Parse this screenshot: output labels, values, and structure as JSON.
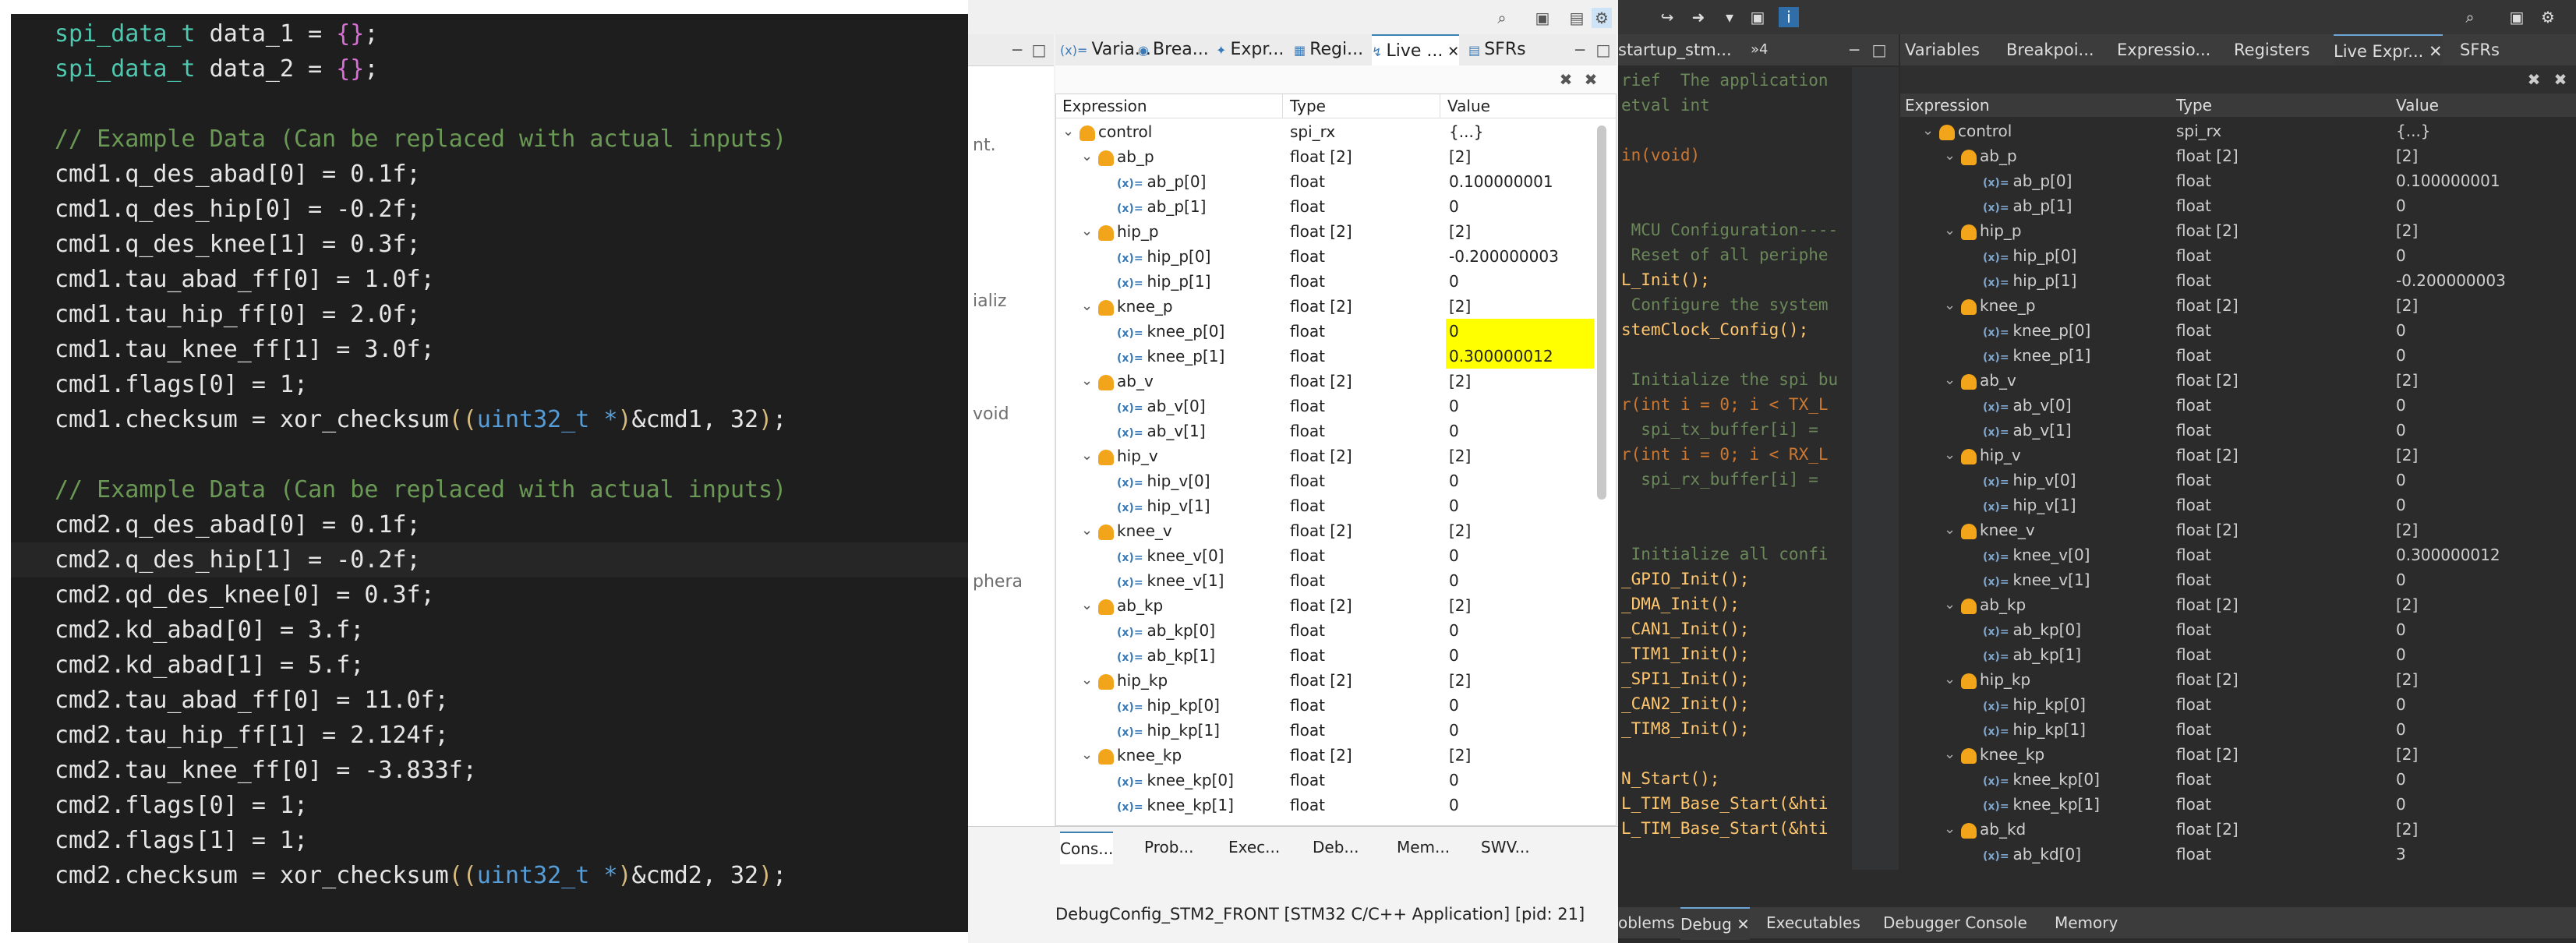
{
  "code": {
    "lines": [
      {
        "text": "spi_data_t data_1 = {};"
      },
      {
        "text": "spi_data_t data_2 = {};"
      },
      {
        "text": ""
      },
      {
        "text": "// Example Data (Can be replaced with actual inputs)"
      },
      {
        "text": "cmd1.q_des_abad[0] = 0.1f;"
      },
      {
        "text": "cmd1.q_des_hip[0] = -0.2f;"
      },
      {
        "text": "cmd1.q_des_knee[1] = 0.3f;"
      },
      {
        "text": "cmd1.tau_abad_ff[0] = 1.0f;"
      },
      {
        "text": "cmd1.tau_hip_ff[0] = 2.0f;"
      },
      {
        "text": "cmd1.tau_knee_ff[1] = 3.0f;"
      },
      {
        "text": "cmd1.flags[0] = 1;"
      },
      {
        "text": "cmd1.checksum = xor_checksum((uint32_t *)&cmd1, 32);"
      },
      {
        "text": ""
      },
      {
        "text": "// Example Data (Can be replaced with actual inputs)"
      },
      {
        "text": "cmd2.q_des_abad[0] = 0.1f;"
      },
      {
        "text": "cmd2.q_des_hip[1] = -0.2f;"
      },
      {
        "text": "cmd2.qd_des_knee[0] = 0.3f;"
      },
      {
        "text": "cmd2.kd_abad[0] = 3.f;"
      },
      {
        "text": "cmd2.kd_abad[1] = 5.f;"
      },
      {
        "text": "cmd2.tau_abad_ff[0] = 11.0f;"
      },
      {
        "text": "cmd2.tau_hip_ff[1] = 2.124f;"
      },
      {
        "text": "cmd2.tau_knee_ff[0] = -3.833f;"
      },
      {
        "text": "cmd2.flags[0] = 1;"
      },
      {
        "text": "cmd2.flags[1] = 1;"
      },
      {
        "text": "cmd2.checksum = xor_checksum((uint32_t *)&cmd2, 32);"
      }
    ]
  },
  "panel_a": {
    "editor_fragments": [
      "nt.",
      "ializ",
      "void",
      "phera"
    ],
    "tabs": [
      "Varia...",
      "Brea...",
      "Expr...",
      "Regi...",
      "Live ...",
      "SFRs"
    ],
    "active_tab": "Live ...",
    "columns": [
      "Expression",
      "Type",
      "Value"
    ],
    "rows": [
      {
        "expr": "control",
        "type": "spi_rx",
        "value": "{...}",
        "level": 0,
        "kind": "struct"
      },
      {
        "expr": "ab_p",
        "type": "float [2]",
        "value": "[2]",
        "level": 1,
        "kind": "struct"
      },
      {
        "expr": "ab_p[0]",
        "type": "float",
        "value": "0.100000001",
        "level": 2,
        "kind": "var"
      },
      {
        "expr": "ab_p[1]",
        "type": "float",
        "value": "0",
        "level": 2,
        "kind": "var"
      },
      {
        "expr": "hip_p",
        "type": "float [2]",
        "value": "[2]",
        "level": 1,
        "kind": "struct"
      },
      {
        "expr": "hip_p[0]",
        "type": "float",
        "value": "-0.200000003",
        "level": 2,
        "kind": "var"
      },
      {
        "expr": "hip_p[1]",
        "type": "float",
        "value": "0",
        "level": 2,
        "kind": "var"
      },
      {
        "expr": "knee_p",
        "type": "float [2]",
        "value": "[2]",
        "level": 1,
        "kind": "struct"
      },
      {
        "expr": "knee_p[0]",
        "type": "float",
        "value": "0",
        "level": 2,
        "kind": "var",
        "highlight": true
      },
      {
        "expr": "knee_p[1]",
        "type": "float",
        "value": "0.300000012",
        "level": 2,
        "kind": "var",
        "highlight": true
      },
      {
        "expr": "ab_v",
        "type": "float [2]",
        "value": "[2]",
        "level": 1,
        "kind": "struct"
      },
      {
        "expr": "ab_v[0]",
        "type": "float",
        "value": "0",
        "level": 2,
        "kind": "var"
      },
      {
        "expr": "ab_v[1]",
        "type": "float",
        "value": "0",
        "level": 2,
        "kind": "var"
      },
      {
        "expr": "hip_v",
        "type": "float [2]",
        "value": "[2]",
        "level": 1,
        "kind": "struct"
      },
      {
        "expr": "hip_v[0]",
        "type": "float",
        "value": "0",
        "level": 2,
        "kind": "var"
      },
      {
        "expr": "hip_v[1]",
        "type": "float",
        "value": "0",
        "level": 2,
        "kind": "var"
      },
      {
        "expr": "knee_v",
        "type": "float [2]",
        "value": "[2]",
        "level": 1,
        "kind": "struct"
      },
      {
        "expr": "knee_v[0]",
        "type": "float",
        "value": "0",
        "level": 2,
        "kind": "var"
      },
      {
        "expr": "knee_v[1]",
        "type": "float",
        "value": "0",
        "level": 2,
        "kind": "var"
      },
      {
        "expr": "ab_kp",
        "type": "float [2]",
        "value": "[2]",
        "level": 1,
        "kind": "struct"
      },
      {
        "expr": "ab_kp[0]",
        "type": "float",
        "value": "0",
        "level": 2,
        "kind": "var"
      },
      {
        "expr": "ab_kp[1]",
        "type": "float",
        "value": "0",
        "level": 2,
        "kind": "var"
      },
      {
        "expr": "hip_kp",
        "type": "float [2]",
        "value": "[2]",
        "level": 1,
        "kind": "struct"
      },
      {
        "expr": "hip_kp[0]",
        "type": "float",
        "value": "0",
        "level": 2,
        "kind": "var"
      },
      {
        "expr": "hip_kp[1]",
        "type": "float",
        "value": "0",
        "level": 2,
        "kind": "var"
      },
      {
        "expr": "knee_kp",
        "type": "float [2]",
        "value": "[2]",
        "level": 1,
        "kind": "struct"
      },
      {
        "expr": "knee_kp[0]",
        "type": "float",
        "value": "0",
        "level": 2,
        "kind": "var"
      },
      {
        "expr": "knee_kp[1]",
        "type": "float",
        "value": "0",
        "level": 2,
        "kind": "var"
      }
    ],
    "console_tabs": [
      "Cons...",
      "Prob...",
      "Exec...",
      "Deb...",
      "Mem...",
      "SWV..."
    ],
    "console_text": "DebugConfig_STM2_FRONT [STM32 C/C++ Application]  [pid: 21]"
  },
  "panel_b": {
    "editor_tab": "startup_stm...",
    "editor_tab_count": "»4",
    "editor_lines": [
      "rief  The application",
      "etval int",
      "",
      "in(void)",
      "",
      "",
      " MCU Configuration----",
      " Reset of all periphe",
      "L_Init();",
      " Configure the system",
      "stemClock_Config();",
      "",
      " Initialize the spi bu",
      "r(int i = 0; i < TX_L",
      "  spi_tx_buffer[i] =",
      "r(int i = 0; i < RX_L",
      "  spi_rx_buffer[i] =",
      "",
      "",
      " Initialize all confi",
      "_GPIO_Init();",
      "_DMA_Init();",
      "_CAN1_Init();",
      "_TIM1_Init();",
      "_SPI1_Init();",
      "_CAN2_Init();",
      "_TIM8_Init();",
      "",
      "N_Start();",
      "L_TIM_Base_Start(&hti",
      "L_TIM_Base_Start(&hti"
    ],
    "tabs": [
      "Variables",
      "Breakpoi...",
      "Expressio...",
      "Registers",
      "Live Expr...",
      "SFRs"
    ],
    "active_tab": "Live Expr...",
    "columns": [
      "Expression",
      "Type",
      "Value"
    ],
    "rows": [
      {
        "expr": "control",
        "type": "spi_rx",
        "value": "{...}",
        "level": 0,
        "kind": "struct"
      },
      {
        "expr": "ab_p",
        "type": "float [2]",
        "value": "[2]",
        "level": 1,
        "kind": "struct"
      },
      {
        "expr": "ab_p[0]",
        "type": "float",
        "value": "0.100000001",
        "level": 2,
        "kind": "var"
      },
      {
        "expr": "ab_p[1]",
        "type": "float",
        "value": "0",
        "level": 2,
        "kind": "var"
      },
      {
        "expr": "hip_p",
        "type": "float [2]",
        "value": "[2]",
        "level": 1,
        "kind": "struct"
      },
      {
        "expr": "hip_p[0]",
        "type": "float",
        "value": "0",
        "level": 2,
        "kind": "var"
      },
      {
        "expr": "hip_p[1]",
        "type": "float",
        "value": "-0.200000003",
        "level": 2,
        "kind": "var"
      },
      {
        "expr": "knee_p",
        "type": "float [2]",
        "value": "[2]",
        "level": 1,
        "kind": "struct"
      },
      {
        "expr": "knee_p[0]",
        "type": "float",
        "value": "0",
        "level": 2,
        "kind": "var"
      },
      {
        "expr": "knee_p[1]",
        "type": "float",
        "value": "0",
        "level": 2,
        "kind": "var"
      },
      {
        "expr": "ab_v",
        "type": "float [2]",
        "value": "[2]",
        "level": 1,
        "kind": "struct"
      },
      {
        "expr": "ab_v[0]",
        "type": "float",
        "value": "0",
        "level": 2,
        "kind": "var"
      },
      {
        "expr": "ab_v[1]",
        "type": "float",
        "value": "0",
        "level": 2,
        "kind": "var"
      },
      {
        "expr": "hip_v",
        "type": "float [2]",
        "value": "[2]",
        "level": 1,
        "kind": "struct"
      },
      {
        "expr": "hip_v[0]",
        "type": "float",
        "value": "0",
        "level": 2,
        "kind": "var"
      },
      {
        "expr": "hip_v[1]",
        "type": "float",
        "value": "0",
        "level": 2,
        "kind": "var"
      },
      {
        "expr": "knee_v",
        "type": "float [2]",
        "value": "[2]",
        "level": 1,
        "kind": "struct"
      },
      {
        "expr": "knee_v[0]",
        "type": "float",
        "value": "0.300000012",
        "level": 2,
        "kind": "var"
      },
      {
        "expr": "knee_v[1]",
        "type": "float",
        "value": "0",
        "level": 2,
        "kind": "var"
      },
      {
        "expr": "ab_kp",
        "type": "float [2]",
        "value": "[2]",
        "level": 1,
        "kind": "struct"
      },
      {
        "expr": "ab_kp[0]",
        "type": "float",
        "value": "0",
        "level": 2,
        "kind": "var"
      },
      {
        "expr": "ab_kp[1]",
        "type": "float",
        "value": "0",
        "level": 2,
        "kind": "var"
      },
      {
        "expr": "hip_kp",
        "type": "float [2]",
        "value": "[2]",
        "level": 1,
        "kind": "struct"
      },
      {
        "expr": "hip_kp[0]",
        "type": "float",
        "value": "0",
        "level": 2,
        "kind": "var"
      },
      {
        "expr": "hip_kp[1]",
        "type": "float",
        "value": "0",
        "level": 2,
        "kind": "var"
      },
      {
        "expr": "knee_kp",
        "type": "float [2]",
        "value": "[2]",
        "level": 1,
        "kind": "struct"
      },
      {
        "expr": "knee_kp[0]",
        "type": "float",
        "value": "0",
        "level": 2,
        "kind": "var"
      },
      {
        "expr": "knee_kp[1]",
        "type": "float",
        "value": "0",
        "level": 2,
        "kind": "var"
      },
      {
        "expr": "ab_kd",
        "type": "float [2]",
        "value": "[2]",
        "level": 1,
        "kind": "struct"
      },
      {
        "expr": "ab_kd[0]",
        "type": "float",
        "value": "3",
        "level": 2,
        "kind": "var"
      }
    ],
    "bottom_tabs": [
      "oblems",
      "Debug",
      "Executables",
      "Debugger Console",
      "Memory"
    ],
    "bottom_active": "Debug"
  },
  "colors": {
    "highlight": "#ffff00",
    "code_bg": "#1e1e1e",
    "comment": "#6a9955",
    "type": "#4ec9b0"
  }
}
